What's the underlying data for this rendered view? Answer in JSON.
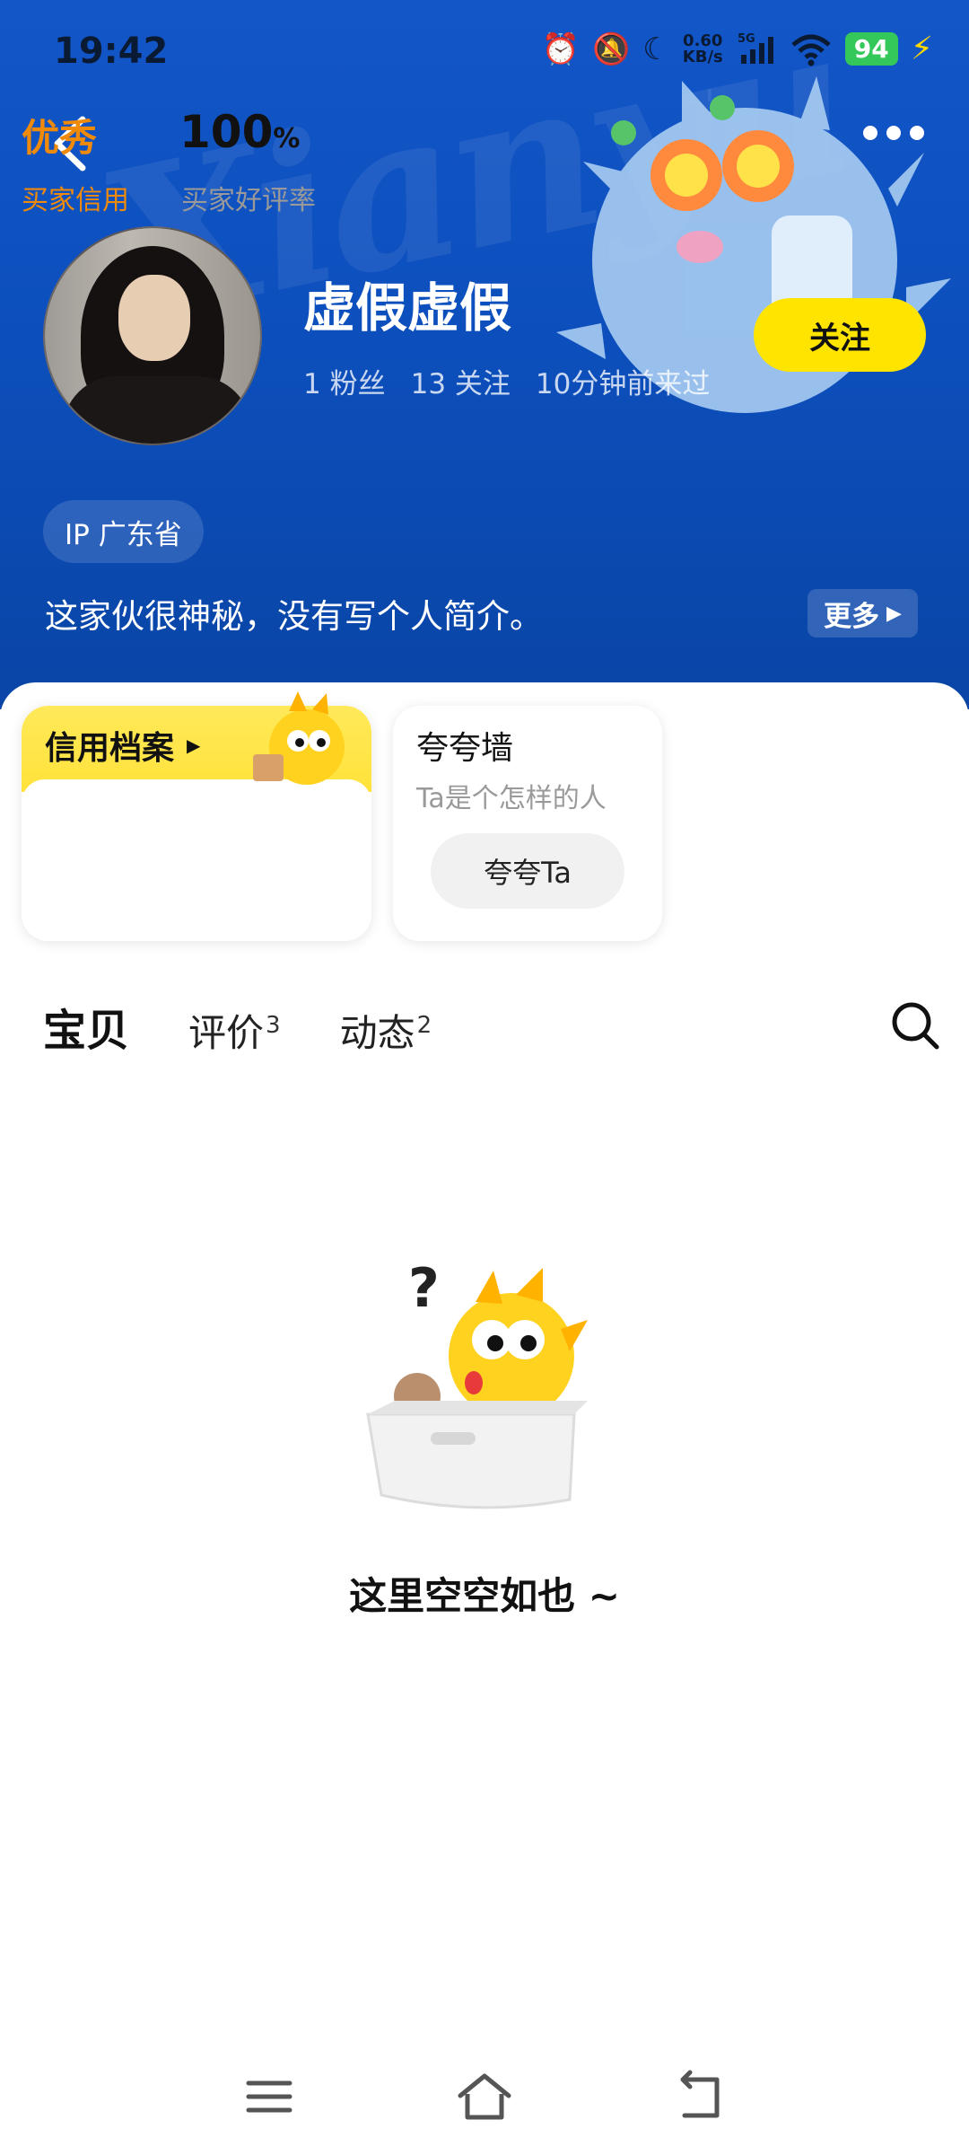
{
  "status_bar": {
    "time": "19:42",
    "net_speed_value": "0.60",
    "net_speed_unit": "KB/s",
    "signal_label": "5G",
    "battery": "94"
  },
  "profile": {
    "name": "虚假虚假",
    "followers_count": "1",
    "followers_label": "粉丝",
    "following_count": "13",
    "following_label": "关注",
    "last_active": "10分钟前来过",
    "follow_button": "关注",
    "ip_location": "IP 广东省",
    "bio": "这家伙很神秘，没有写个人简介。",
    "more_button": "更多"
  },
  "credit_card": {
    "title": "信用档案",
    "level": "优秀",
    "level_label": "买家信用",
    "rate_value": "100",
    "rate_unit": "%",
    "rate_label": "买家好评率"
  },
  "praise_card": {
    "title": "夸夸墙",
    "subtitle": "Ta是个怎样的人",
    "button": "夸夸Ta"
  },
  "tabs": [
    {
      "label": "宝贝",
      "count": ""
    },
    {
      "label": "评价",
      "count": "3"
    },
    {
      "label": "动态",
      "count": "2"
    }
  ],
  "empty_state": {
    "text": "这里空空如也 ~"
  },
  "colors": {
    "header_blue": "#0c4fbd",
    "accent_yellow": "#ffe400",
    "credit_orange": "#f08a0a"
  }
}
